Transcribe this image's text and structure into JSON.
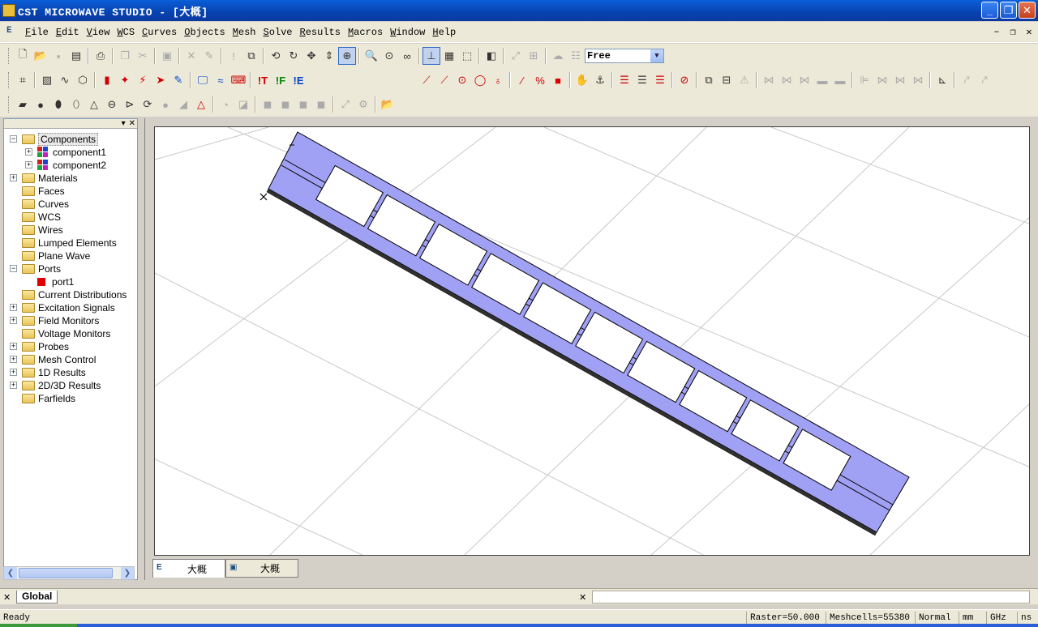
{
  "window": {
    "title": "CST MICROWAVE STUDIO - [大概]",
    "minimize": "_",
    "maximize": "❐",
    "close": "✕"
  },
  "menu": {
    "items": [
      {
        "key": "F",
        "rest": "ile"
      },
      {
        "key": "E",
        "rest": "dit"
      },
      {
        "key": "V",
        "rest": "iew"
      },
      {
        "key": "W",
        "rest": "CS"
      },
      {
        "key": "C",
        "rest": "urves"
      },
      {
        "key": "O",
        "rest": "bjects"
      },
      {
        "key": "M",
        "rest": "esh"
      },
      {
        "key": "S",
        "rest": "olve"
      },
      {
        "key": "R",
        "rest": "esults"
      },
      {
        "key": "M",
        "rest": "acros"
      },
      {
        "key": "W",
        "rest": "indow"
      },
      {
        "key": "H",
        "rest": "elp"
      }
    ]
  },
  "toolbar": {
    "view_mode_select": "Free"
  },
  "tree": {
    "items": [
      {
        "label": "Components",
        "depth": 0,
        "expander": "−",
        "icon": "folder-icon",
        "selected": true
      },
      {
        "label": "component1",
        "depth": 1,
        "expander": "+",
        "icon": "component-icon"
      },
      {
        "label": "component2",
        "depth": 1,
        "expander": "+",
        "icon": "component-icon"
      },
      {
        "label": "Materials",
        "depth": 0,
        "expander": "+",
        "icon": "folder-icon"
      },
      {
        "label": "Faces",
        "depth": 0,
        "expander": "",
        "icon": "folder-icon"
      },
      {
        "label": "Curves",
        "depth": 0,
        "expander": "",
        "icon": "folder-icon"
      },
      {
        "label": "WCS",
        "depth": 0,
        "expander": "",
        "icon": "folder-icon"
      },
      {
        "label": "Wires",
        "depth": 0,
        "expander": "",
        "icon": "folder-icon"
      },
      {
        "label": "Lumped Elements",
        "depth": 0,
        "expander": "",
        "icon": "folder-icon"
      },
      {
        "label": "Plane Wave",
        "depth": 0,
        "expander": "",
        "icon": "folder-icon"
      },
      {
        "label": "Ports",
        "depth": 0,
        "expander": "−",
        "icon": "folder-icon"
      },
      {
        "label": "port1",
        "depth": 1,
        "expander": "",
        "icon": "port-icon"
      },
      {
        "label": "Current Distributions",
        "depth": 0,
        "expander": "",
        "icon": "folder-icon"
      },
      {
        "label": "Excitation Signals",
        "depth": 0,
        "expander": "+",
        "icon": "folder-icon"
      },
      {
        "label": "Field Monitors",
        "depth": 0,
        "expander": "+",
        "icon": "folder-icon"
      },
      {
        "label": "Voltage Monitors",
        "depth": 0,
        "expander": "",
        "icon": "folder-icon"
      },
      {
        "label": "Probes",
        "depth": 0,
        "expander": "+",
        "icon": "folder-icon"
      },
      {
        "label": "Mesh Control",
        "depth": 0,
        "expander": "+",
        "icon": "folder-icon"
      },
      {
        "label": "1D Results",
        "depth": 0,
        "expander": "+",
        "icon": "folder-icon"
      },
      {
        "label": "2D/3D Results",
        "depth": 0,
        "expander": "+",
        "icon": "folder-icon"
      },
      {
        "label": "Farfields",
        "depth": 0,
        "expander": "",
        "icon": "folder-icon"
      }
    ]
  },
  "doc_tabs": [
    {
      "label": "大概",
      "icon": "3d-view-icon"
    },
    {
      "label": "大概",
      "icon": "schematic-icon"
    }
  ],
  "messages": {
    "tab": "Global"
  },
  "status": {
    "text": "Ready",
    "raster": "Raster=50.000",
    "meshcells": "Meshcells=55380",
    "mode": "Normal",
    "length_unit": "mm",
    "freq_unit": "GHz",
    "time_unit": "ns"
  },
  "colors": {
    "substrate": "#a0a0f4",
    "title_bar": "#0842b0",
    "port": "#e00000"
  }
}
